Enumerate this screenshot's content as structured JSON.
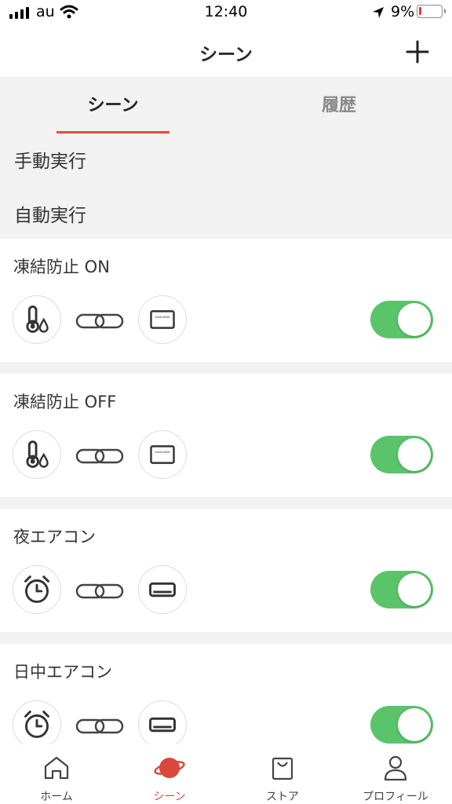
{
  "status_bar": {
    "carrier": "au",
    "time": "12:40",
    "battery": "9%"
  },
  "header": {
    "title": "シーン"
  },
  "tabs": [
    {
      "label": "シーン",
      "active": true
    },
    {
      "label": "履歴",
      "active": false
    }
  ],
  "filters": [
    {
      "label": "手動実行"
    },
    {
      "label": "自動実行"
    }
  ],
  "scenes": [
    {
      "title": "凍結防止 ON",
      "condition_icon": "thermometer-water-icon",
      "action_icon": "switchbot-device-icon",
      "enabled": true
    },
    {
      "title": "凍結防止 OFF",
      "condition_icon": "thermometer-water-icon",
      "action_icon": "switchbot-device-icon",
      "enabled": true
    },
    {
      "title": "夜エアコン",
      "condition_icon": "alarm-clock-icon",
      "action_icon": "air-conditioner-icon",
      "enabled": true
    },
    {
      "title": "日中エアコン",
      "condition_icon": "alarm-clock-icon",
      "action_icon": "air-conditioner-icon",
      "enabled": true
    }
  ],
  "device_label": "SwitchBot",
  "bottom_nav": [
    {
      "label": "ホーム",
      "icon": "home-icon",
      "active": false
    },
    {
      "label": "シーン",
      "icon": "planet-icon",
      "active": true
    },
    {
      "label": "ストア",
      "icon": "shopping-bag-icon",
      "active": false
    },
    {
      "label": "プロフィール",
      "icon": "profile-icon",
      "active": false
    }
  ],
  "colors": {
    "accent": "#e64a3b",
    "toggle_on": "#5ac46b",
    "section_bg": "#f2f2f2"
  }
}
